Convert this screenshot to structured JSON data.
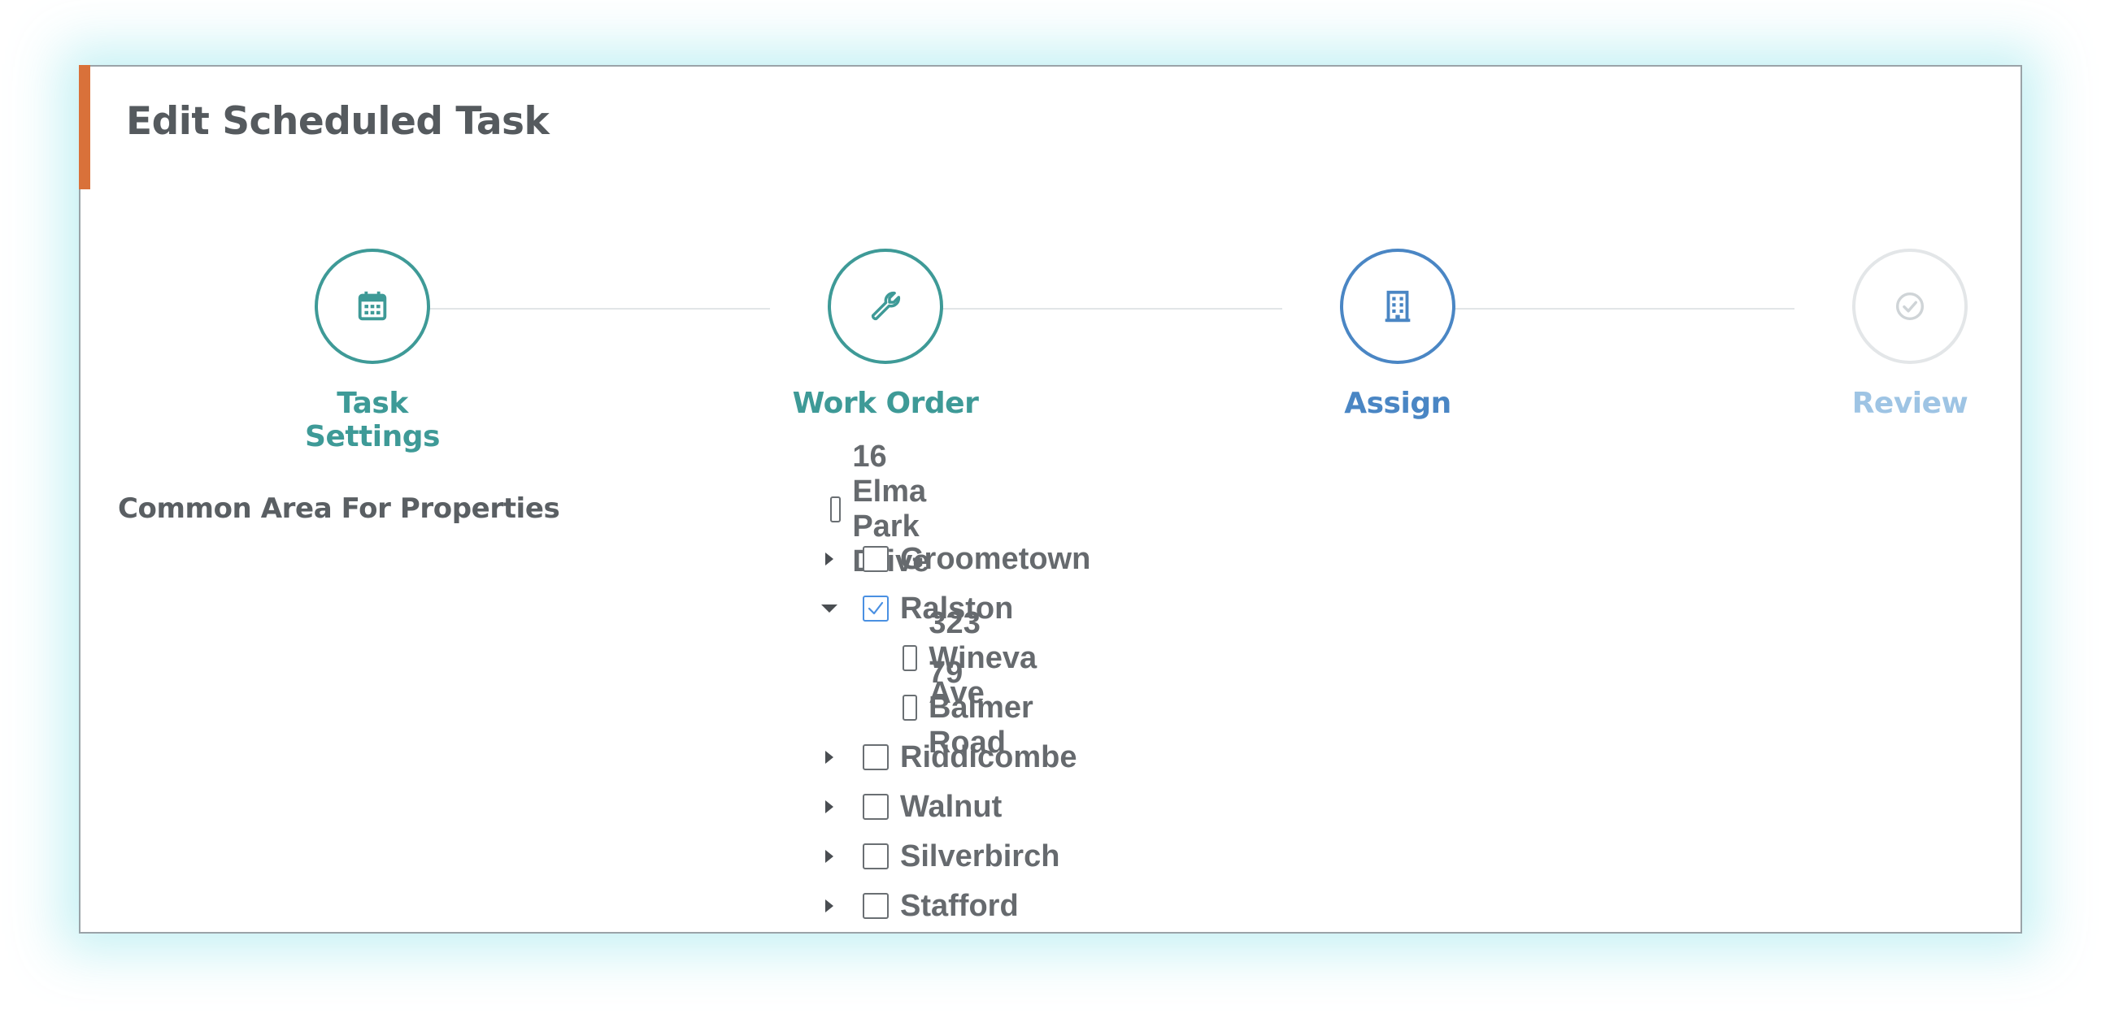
{
  "page": {
    "title": "Edit Scheduled Task"
  },
  "colors": {
    "accent_bar": "#d9713a",
    "teal": "#3e9a97",
    "blue": "#4a86c4",
    "pending": "#9ec4e4"
  },
  "steps": [
    {
      "label": "Task Settings",
      "icon": "calendar-icon",
      "state": "complete"
    },
    {
      "label": "Work Order",
      "icon": "wrench-icon",
      "state": "complete"
    },
    {
      "label": "Assign",
      "icon": "building-icon",
      "state": "active"
    },
    {
      "label": "Review",
      "icon": "check-circle-icon",
      "state": "pending"
    }
  ],
  "form": {
    "field_label": "Common Area For Properties",
    "tree": [
      {
        "label": "16 Elma Park Drive",
        "checked": false,
        "expandable": false
      },
      {
        "label": "Groometown",
        "checked": false,
        "expandable": true,
        "expanded": false
      },
      {
        "label": "Ralston",
        "checked": true,
        "expandable": true,
        "expanded": true,
        "children": [
          {
            "label": "323 Wineva Ave",
            "checked": false
          },
          {
            "label": "79 Balmer Road",
            "checked": false
          }
        ]
      },
      {
        "label": "Riddicombe",
        "checked": false,
        "expandable": true,
        "expanded": false
      },
      {
        "label": "Walnut",
        "checked": false,
        "expandable": true,
        "expanded": false
      },
      {
        "label": "Silverbirch",
        "checked": false,
        "expandable": true,
        "expanded": false
      },
      {
        "label": "Stafford",
        "checked": false,
        "expandable": true,
        "expanded": false
      }
    ]
  }
}
